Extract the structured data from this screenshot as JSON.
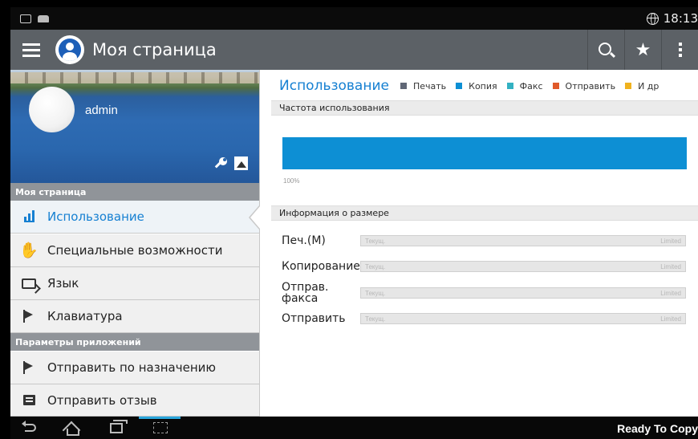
{
  "status_bar": {
    "time": "18:13"
  },
  "action_bar": {
    "title": "Моя страница"
  },
  "profile": {
    "name": "admin"
  },
  "sections": {
    "my_page": "Моя страница",
    "app_params": "Параметры приложений"
  },
  "nav": {
    "usage": "Использование",
    "accessibility": "Специальные возможности",
    "language": "Язык",
    "keyboard": "Клавиатура",
    "send_to": "Отправить по назначению",
    "feedback": "Отправить отзыв"
  },
  "usage": {
    "title": "Использование",
    "legend": [
      {
        "label": "Печать",
        "color": "#606776"
      },
      {
        "label": "Копия",
        "color": "#0d8fd4"
      },
      {
        "label": "Факс",
        "color": "#33b1c2"
      },
      {
        "label": "Отправить",
        "color": "#e05a2a"
      },
      {
        "label": "И др",
        "color": "#f0b21e"
      }
    ],
    "frequency_header": "Частота использования",
    "bar_percent": "100%"
  },
  "size_info": {
    "header": "Информация о размере",
    "rows": [
      {
        "label": "Печ.(М)",
        "current": "Текущ.",
        "limit": "Limited"
      },
      {
        "label": "Копирование(М)",
        "current": "Текущ.",
        "limit": "Limited"
      },
      {
        "label": "Отправ. факса",
        "current": "Текущ.",
        "limit": "Limited"
      },
      {
        "label": "Отправить",
        "current": "Текущ.",
        "limit": "Limited"
      }
    ]
  },
  "footer": {
    "status": "Ready To Copy"
  }
}
